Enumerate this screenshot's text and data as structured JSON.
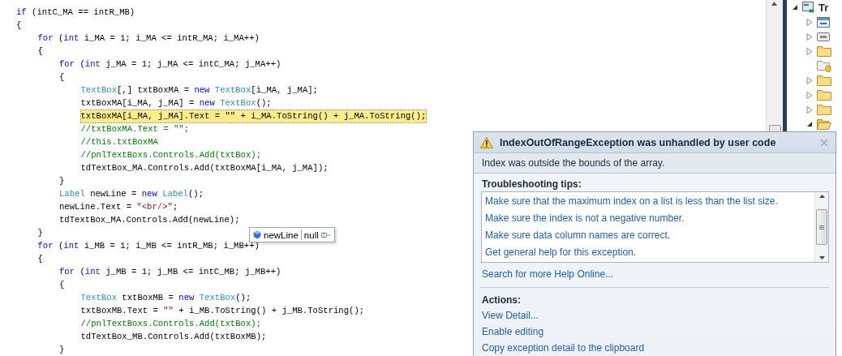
{
  "code": {
    "lines": [
      {
        "highlighted": false,
        "tokens": [
          {
            "kind": "keyword",
            "text": "if"
          },
          {
            "kind": "plain",
            "text": " (intC_MA == intR_MB)"
          }
        ]
      },
      {
        "highlighted": false,
        "tokens": [
          {
            "kind": "plain",
            "text": "{"
          }
        ],
        "children": [
          {
            "highlighted": false,
            "tokens": [
              {
                "kind": "keyword",
                "text": "for"
              },
              {
                "kind": "plain",
                "text": " ("
              },
              {
                "kind": "keyword",
                "text": "int"
              },
              {
                "kind": "plain",
                "text": " i_MA = 1; i_MA <= intR_MA; i_MA++)"
              }
            ]
          },
          {
            "highlighted": false,
            "tokens": [
              {
                "kind": "plain",
                "text": "{"
              }
            ],
            "children": [
              {
                "highlighted": false,
                "tokens": [
                  {
                    "kind": "keyword",
                    "text": "for"
                  },
                  {
                    "kind": "plain",
                    "text": " ("
                  },
                  {
                    "kind": "keyword",
                    "text": "int"
                  },
                  {
                    "kind": "plain",
                    "text": " j_MA = 1; j_MA <= intC_MA; j_MA++)"
                  }
                ]
              },
              {
                "highlighted": false,
                "tokens": [
                  {
                    "kind": "plain",
                    "text": "{"
                  }
                ],
                "children": [
                  {
                    "highlighted": false,
                    "tokens": [
                      {
                        "kind": "type",
                        "text": "TextBox"
                      },
                      {
                        "kind": "plain",
                        "text": "[,] txtBoxMA = "
                      },
                      {
                        "kind": "keyword",
                        "text": "new"
                      },
                      {
                        "kind": "type",
                        "text": " TextBox"
                      },
                      {
                        "kind": "plain",
                        "text": "[i_MA, j_MA];"
                      }
                    ]
                  },
                  {
                    "highlighted": false,
                    "tokens": [
                      {
                        "kind": "plain",
                        "text": "txtBoxMA[i_MA, j_MA] = "
                      },
                      {
                        "kind": "keyword",
                        "text": "new"
                      },
                      {
                        "kind": "type",
                        "text": " TextBox"
                      },
                      {
                        "kind": "plain",
                        "text": "();"
                      }
                    ]
                  },
                  {
                    "highlighted": true,
                    "tokens": [
                      {
                        "kind": "plain",
                        "text": "txtBoxMA[i_MA, j_MA].Text = \"\" + i_MA.ToString() + j_MA.ToString();"
                      }
                    ]
                  },
                  {
                    "highlighted": false,
                    "tokens": [
                      {
                        "kind": "comment",
                        "text": "//txtBoxMA.Text = \"\";"
                      }
                    ]
                  },
                  {
                    "highlighted": false,
                    "tokens": [
                      {
                        "kind": "comment",
                        "text": "//this.txtBoxMA"
                      }
                    ]
                  },
                  {
                    "highlighted": false,
                    "tokens": [
                      {
                        "kind": "comment",
                        "text": "//pnlTextBoxs.Controls.Add(txtBox);"
                      }
                    ]
                  },
                  {
                    "highlighted": false,
                    "tokens": [
                      {
                        "kind": "plain",
                        "text": "tdTextBox_MA.Controls.Add(txtBoxMA[i_MA, j_MA]);"
                      }
                    ]
                  }
                ]
              },
              {
                "highlighted": false,
                "tokens": [
                  {
                    "kind": "plain",
                    "text": "}"
                  }
                ]
              },
              {
                "highlighted": false,
                "tokens": [
                  {
                    "kind": "type",
                    "text": "Label"
                  },
                  {
                    "kind": "plain",
                    "text": " newLine = "
                  },
                  {
                    "kind": "keyword",
                    "text": "new"
                  },
                  {
                    "kind": "type",
                    "text": " Label"
                  },
                  {
                    "kind": "plain",
                    "text": "();"
                  }
                ]
              },
              {
                "highlighted": false,
                "tokens": [
                  {
                    "kind": "plain",
                    "text": "newLine.Text = "
                  },
                  {
                    "kind": "string",
                    "text": "\"<br/>\""
                  },
                  {
                    "kind": "plain",
                    "text": ";"
                  }
                ]
              },
              {
                "highlighted": false,
                "tokens": [
                  {
                    "kind": "plain",
                    "text": "tdTextBox_MA.Controls.Add(newLine);"
                  }
                ]
              }
            ]
          },
          {
            "highlighted": false,
            "tokens": [
              {
                "kind": "plain",
                "text": "}"
              }
            ]
          },
          {
            "highlighted": false,
            "tokens": [
              {
                "kind": "keyword",
                "text": "for"
              },
              {
                "kind": "plain",
                "text": " ("
              },
              {
                "kind": "keyword",
                "text": "int"
              },
              {
                "kind": "plain",
                "text": " i_MB = 1; i_MB <= intR_MB; i_MB++)"
              }
            ]
          },
          {
            "highlighted": false,
            "tokens": [
              {
                "kind": "plain",
                "text": "{"
              }
            ],
            "children": [
              {
                "highlighted": false,
                "tokens": [
                  {
                    "kind": "keyword",
                    "text": "for"
                  },
                  {
                    "kind": "plain",
                    "text": " ("
                  },
                  {
                    "kind": "keyword",
                    "text": "int"
                  },
                  {
                    "kind": "plain",
                    "text": " j_MB = 1; j_MB <= intC_MB; j_MB++)"
                  }
                ]
              },
              {
                "highlighted": false,
                "tokens": [
                  {
                    "kind": "plain",
                    "text": "{"
                  }
                ],
                "children": [
                  {
                    "highlighted": false,
                    "tokens": [
                      {
                        "kind": "type",
                        "text": "TextBox"
                      },
                      {
                        "kind": "plain",
                        "text": " txtBoxMB = "
                      },
                      {
                        "kind": "keyword",
                        "text": "new"
                      },
                      {
                        "kind": "type",
                        "text": " TextBox"
                      },
                      {
                        "kind": "plain",
                        "text": "();"
                      }
                    ]
                  },
                  {
                    "highlighted": false,
                    "tokens": [
                      {
                        "kind": "plain",
                        "text": "txtBoxMB.Text = "
                      },
                      {
                        "kind": "string",
                        "text": "\"\""
                      },
                      {
                        "kind": "plain",
                        "text": " + i_MB.ToString() + j_MB.ToString();"
                      }
                    ]
                  },
                  {
                    "highlighted": false,
                    "tokens": [
                      {
                        "kind": "comment",
                        "text": "//pnlTextBoxs.Controls.Add(txtBox);"
                      }
                    ]
                  },
                  {
                    "highlighted": false,
                    "tokens": [
                      {
                        "kind": "plain",
                        "text": "tdTextBox_MB.Controls.Add(txtBoxMB);"
                      }
                    ]
                  }
                ]
              },
              {
                "highlighted": false,
                "tokens": [
                  {
                    "kind": "plain",
                    "text": "}"
                  }
                ]
              }
            ]
          }
        ]
      }
    ]
  },
  "datatip": {
    "name": "newLine",
    "value": "null"
  },
  "solution_explorer": {
    "root": {
      "label": "Tr",
      "kind": "project",
      "expanded": true,
      "children": [
        {
          "kind": "properties",
          "expandable": true,
          "expanded": false
        },
        {
          "kind": "references",
          "expandable": true,
          "expanded": false
        },
        {
          "kind": "folder",
          "expandable": true,
          "expanded": false
        },
        {
          "kind": "app-data",
          "expandable": false
        },
        {
          "kind": "folder",
          "expandable": true,
          "expanded": false
        },
        {
          "kind": "folder",
          "expandable": true,
          "expanded": false
        },
        {
          "kind": "folder",
          "expandable": true,
          "expanded": false
        },
        {
          "kind": "folder",
          "expandable": true,
          "expanded": true
        }
      ]
    }
  },
  "exception": {
    "title": "IndexOutOfRangeException was unhandled by user code",
    "message": "Index was outside the bounds of the array.",
    "tips_heading": "Troubleshooting tips:",
    "tips": [
      "Make sure that the maximum index on a list is less than the list size.",
      "Make sure the index is not a negative number.",
      "Make sure data column names are correct.",
      "Get general help for this exception."
    ],
    "search_link": "Search for more Help Online...",
    "actions_heading": "Actions:",
    "actions": [
      "View Detail...",
      "Enable editing",
      "Copy exception detail to the clipboard"
    ]
  }
}
